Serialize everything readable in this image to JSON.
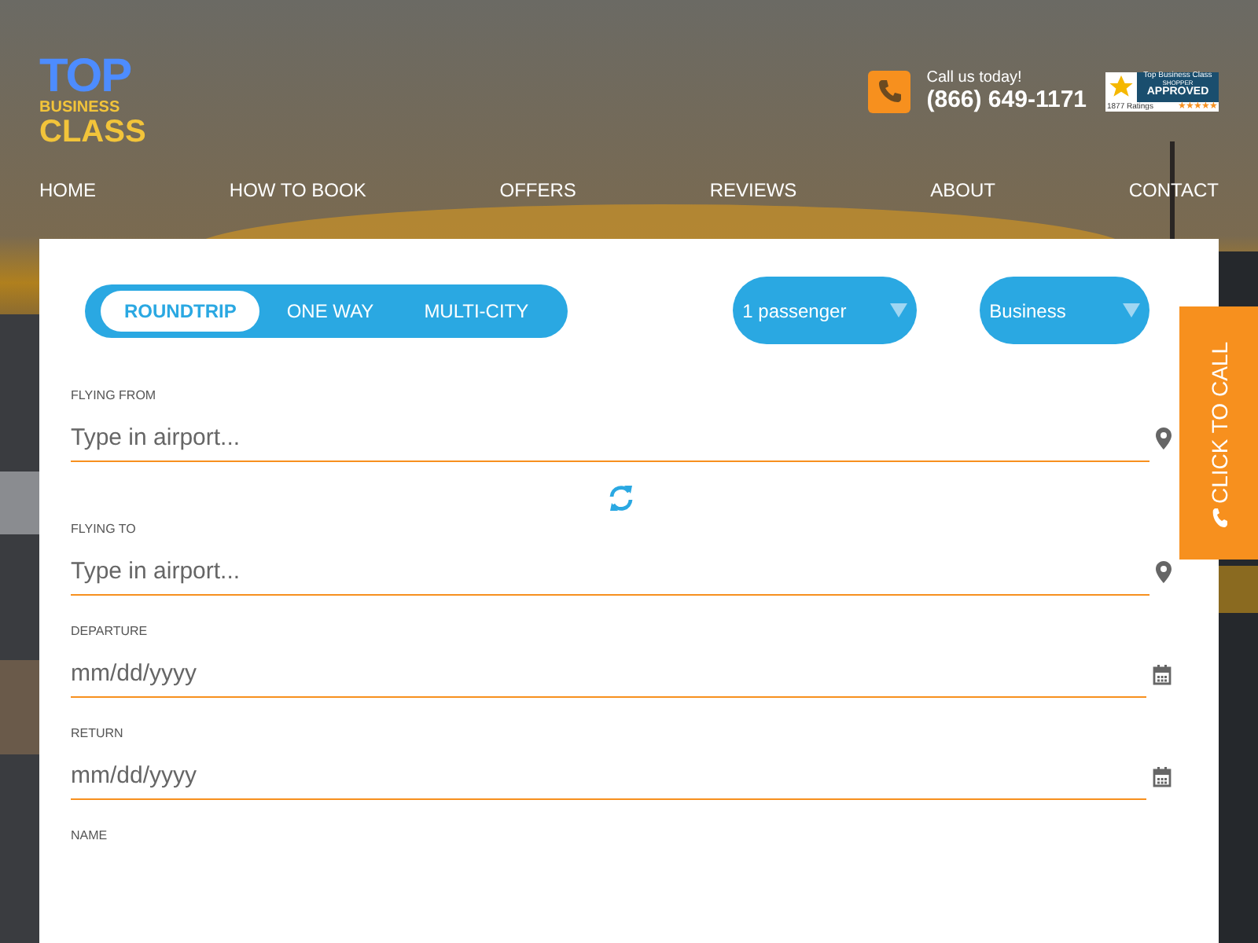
{
  "logo": {
    "top": "TOP",
    "middle": "BUSINESS",
    "bottom": "CLASS"
  },
  "contact": {
    "caption": "Call us today!",
    "phone": "(866) 649-1171"
  },
  "badge": {
    "title": "Top Business Class",
    "line1": "SHOPPER",
    "line2": "APPROVED",
    "ratings": "1877 Ratings",
    "stars": 5
  },
  "nav": [
    "HOME",
    "HOW TO BOOK",
    "OFFERS",
    "REVIEWS",
    "ABOUT",
    "CONTACT"
  ],
  "trip_types": [
    {
      "label": "ROUNDTRIP",
      "selected": true
    },
    {
      "label": "ONE WAY",
      "selected": false
    },
    {
      "label": "MULTI-CITY",
      "selected": false
    }
  ],
  "selects": [
    {
      "value": "1 passenger"
    },
    {
      "value": "Business"
    }
  ],
  "fields": [
    {
      "label": "FLYING FROM",
      "placeholder": "Type in airport...",
      "kind": "airport"
    },
    {
      "kind": "swap"
    },
    {
      "label": "FLYING TO",
      "placeholder": "Type in airport...",
      "kind": "airport"
    },
    {
      "label": "DEPARTURE",
      "placeholder": "mm/dd/yyyy",
      "kind": "date"
    },
    {
      "label": "RETURN",
      "placeholder": "mm/dd/yyyy",
      "kind": "date"
    },
    {
      "label": "NAME",
      "kind": "label"
    }
  ],
  "call_tab": "CLICK TO CALL"
}
